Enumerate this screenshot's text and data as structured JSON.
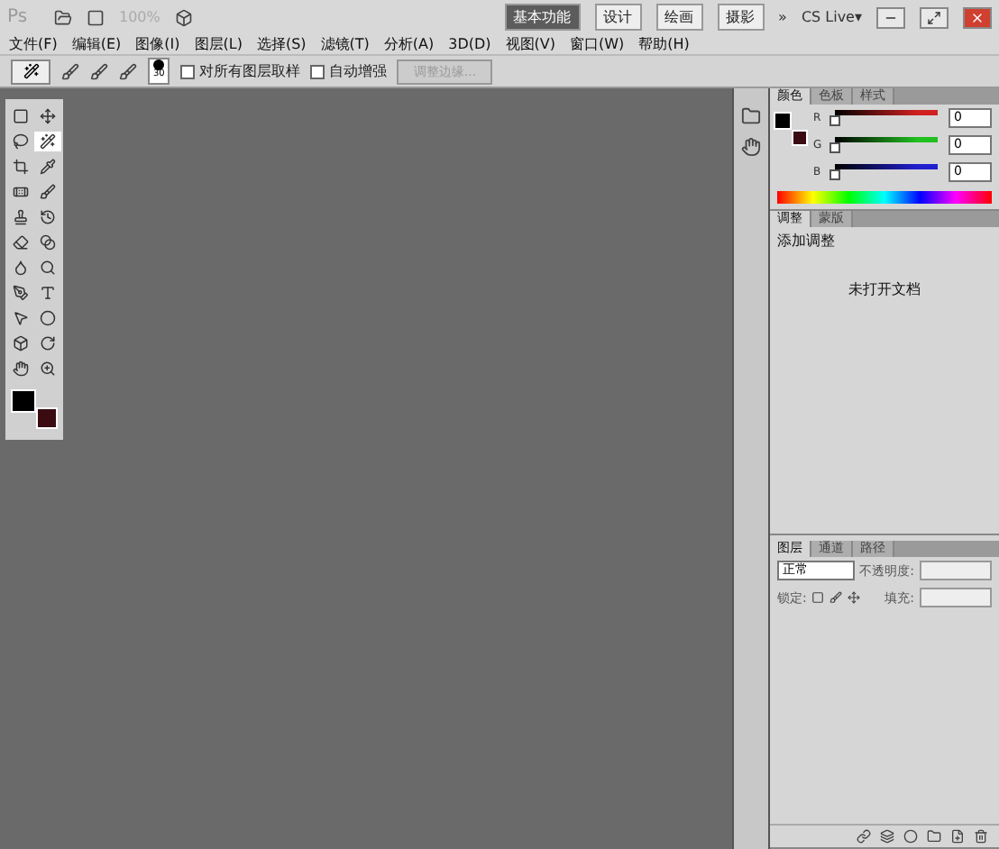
{
  "app_bar": {
    "logo": "Ps",
    "zoom": "100%",
    "workspaces": [
      {
        "label": "基本功能",
        "selected": true
      },
      {
        "label": "设计",
        "selected": false
      },
      {
        "label": "绘画",
        "selected": false
      },
      {
        "label": "摄影",
        "selected": false
      }
    ],
    "more": "»",
    "cs_live": "CS Live▾"
  },
  "menu": [
    "文件(F)",
    "编辑(E)",
    "图像(I)",
    "图层(L)",
    "选择(S)",
    "滤镜(T)",
    "分析(A)",
    "3D(D)",
    "视图(V)",
    "窗口(W)",
    "帮助(H)"
  ],
  "options_bar": {
    "brush_size": "30",
    "checkboxes": [
      {
        "label": "对所有图层取样",
        "checked": false
      },
      {
        "label": "自动增强",
        "checked": false
      }
    ],
    "refine_button": {
      "label": "调整边缘...",
      "disabled": true
    }
  },
  "tools": [
    {
      "selected": false
    },
    {
      "selected": false
    },
    {
      "selected": false
    },
    {
      "selected": true
    },
    {
      "selected": false
    },
    {
      "selected": false
    },
    {
      "selected": false
    },
    {
      "selected": false
    },
    {
      "selected": false
    },
    {
      "selected": false
    },
    {
      "selected": false
    },
    {
      "selected": false
    },
    {
      "selected": false
    },
    {
      "selected": false
    },
    {
      "selected": false
    },
    {
      "selected": false
    },
    {
      "selected": false
    },
    {
      "selected": false
    },
    {
      "selected": false
    },
    {
      "selected": false
    },
    {
      "selected": false
    },
    {
      "selected": false
    }
  ],
  "swatches": [
    {
      "color": "#000000"
    },
    {
      "color": "#3a0c12"
    }
  ],
  "color_panel": {
    "tabs": [
      {
        "label": "颜色",
        "selected": true
      },
      {
        "label": "色板",
        "selected": false
      },
      {
        "label": "样式",
        "selected": false
      }
    ],
    "channels": [
      {
        "name": "R",
        "color": "#d02020",
        "level": 0,
        "value": "0"
      },
      {
        "name": "G",
        "color": "#20c020",
        "level": 0,
        "value": "0"
      },
      {
        "name": "B",
        "color": "#2020d0",
        "level": 0,
        "value": "0"
      }
    ]
  },
  "adjust_panel": {
    "tabs": [
      {
        "label": "调整",
        "selected": true
      },
      {
        "label": "蒙版",
        "selected": false
      }
    ],
    "heading": "添加调整",
    "message": "未打开文档"
  },
  "layers_panel": {
    "tabs": [
      {
        "label": "图层",
        "selected": true
      },
      {
        "label": "通道",
        "selected": false
      },
      {
        "label": "路径",
        "selected": false
      }
    ],
    "blend_mode": "正常",
    "opacity_label": "不透明度:",
    "lock_label": "锁定:",
    "fill_label": "填充:"
  }
}
